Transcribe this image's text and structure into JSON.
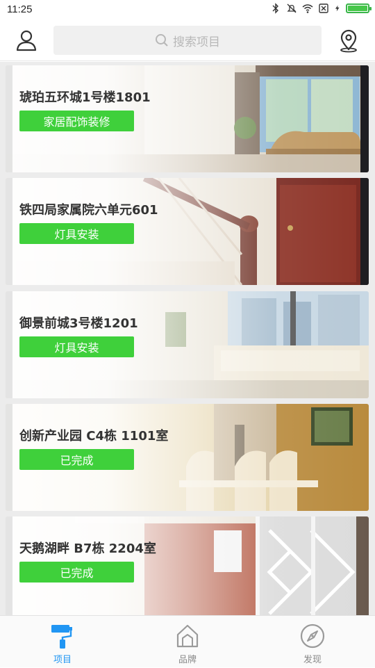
{
  "status_bar": {
    "time": "11:25",
    "icons": [
      "bluetooth-icon",
      "mute-icon",
      "wifi-icon",
      "sim-icon",
      "charging-icon",
      "battery-icon"
    ],
    "battery_level": 1.0
  },
  "header": {
    "search_placeholder": "搜索项目",
    "left_icon": "user-icon",
    "right_icon": "location-icon"
  },
  "projects": [
    {
      "title": "琥珀五环城1号楼1801",
      "status": "家居配饰装修"
    },
    {
      "title": "铁四局家属院六单元601",
      "status": "灯具安装"
    },
    {
      "title": "御景前城3号楼1201",
      "status": "灯具安装"
    },
    {
      "title": "创新产业园 C4栋 1101室",
      "status": "已完成"
    },
    {
      "title": "天鹅湖畔 B7栋 2204室",
      "status": "已完成"
    }
  ],
  "tabs": [
    {
      "label": "项目",
      "icon": "paint-roller-icon",
      "active": true
    },
    {
      "label": "品牌",
      "icon": "house-icon",
      "active": false
    },
    {
      "label": "发现",
      "icon": "compass-icon",
      "active": false
    }
  ],
  "colors": {
    "accent_green": "#3fd03b",
    "tab_active": "#2196f3",
    "tab_inactive": "#888888"
  }
}
